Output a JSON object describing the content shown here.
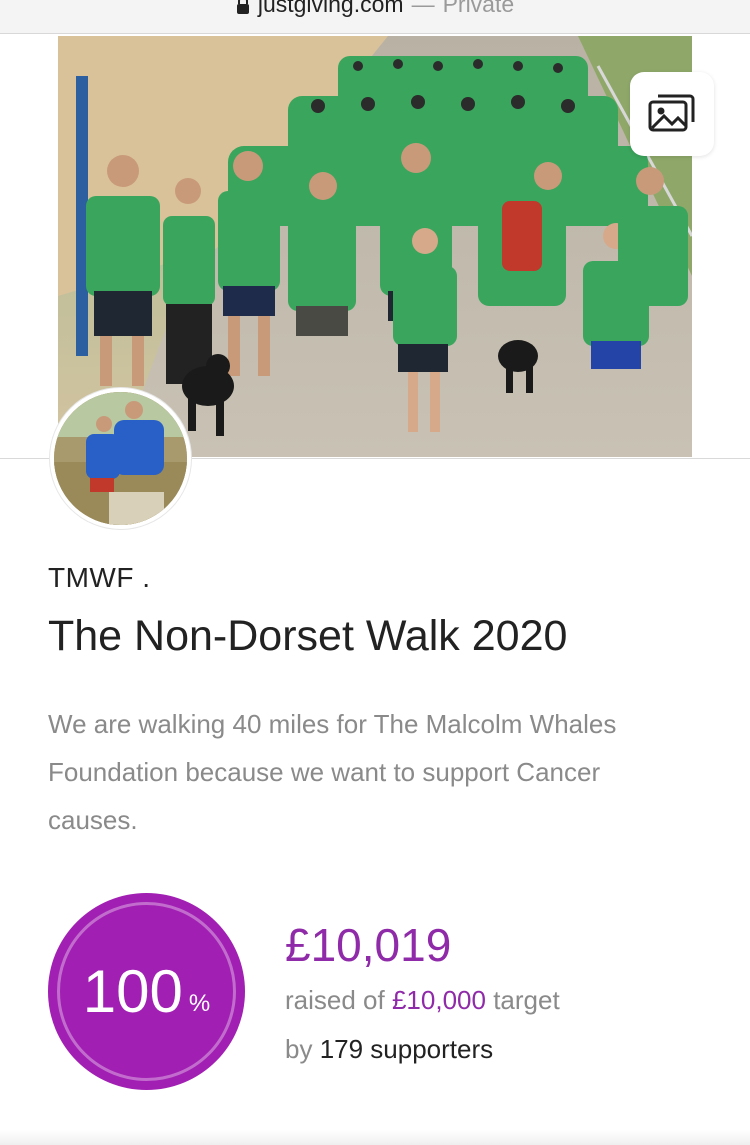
{
  "browser": {
    "domain": "justgiving.com",
    "separator": "—",
    "mode": "Private",
    "lock_icon": "lock-icon"
  },
  "hero": {
    "gallery_icon": "image-gallery-icon"
  },
  "fundraiser": {
    "owner": "TMWF .",
    "title": "The Non-Dorset Walk 2020",
    "description": "We are walking 40 miles for The Malcolm Whales Foundation because we want to support Cancer causes."
  },
  "progress": {
    "percent": "100",
    "percent_sign": "%",
    "raised": "£10,019",
    "raised_prefix": "raised of",
    "target": "£10,000",
    "target_suffix": "target",
    "by_label": "by",
    "supporters": "179 supporters"
  },
  "colors": {
    "accent": "#a11fb3",
    "amount": "#8f2aa8",
    "muted_text": "#8a8a8a",
    "shirt_green": "#3aa55c"
  }
}
